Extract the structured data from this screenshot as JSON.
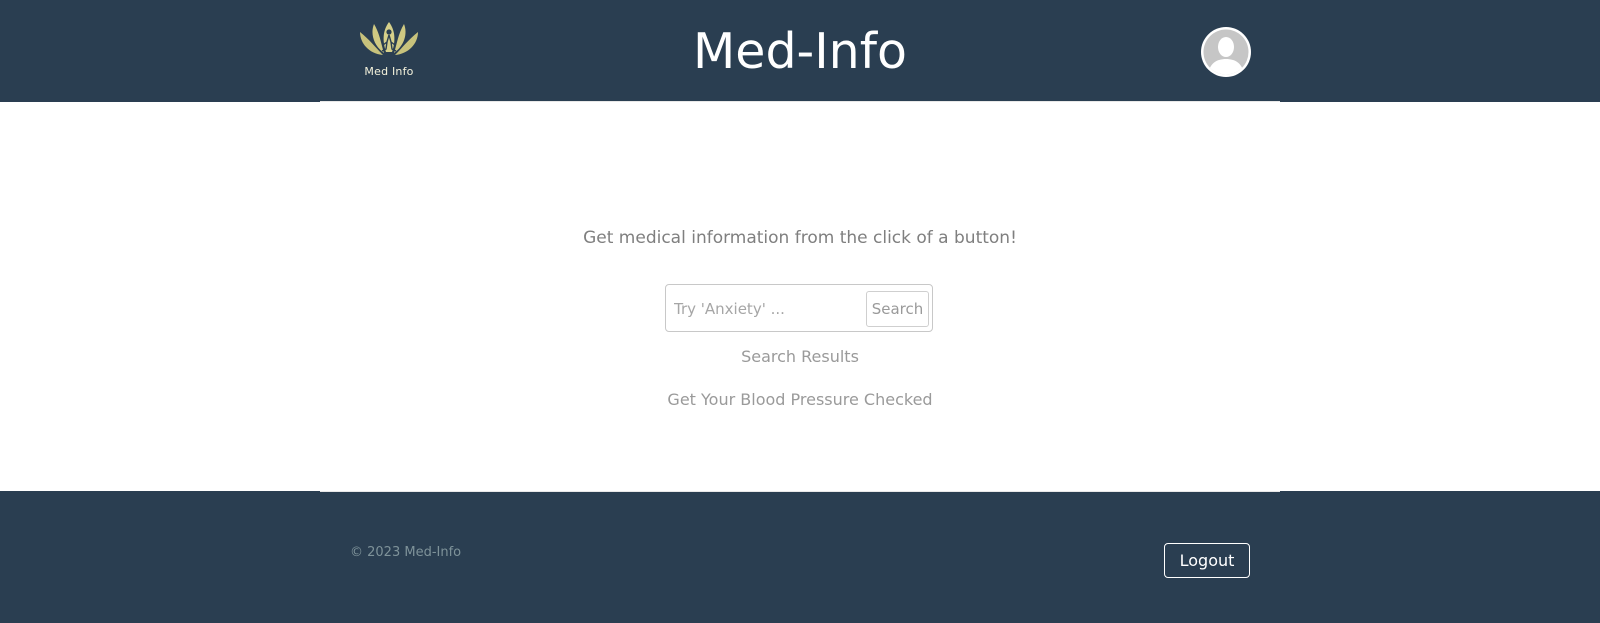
{
  "header": {
    "logo_text": "Med Info",
    "title": "Med-Info",
    "avatar_icon": "user-avatar-icon"
  },
  "main": {
    "tagline": "Get medical information from the click of a button!",
    "search": {
      "placeholder": "Try 'Anxiety' ...",
      "value": "",
      "button_label": "Search"
    },
    "search_results_label": "Search Results",
    "bp_link": "Get Your Blood Pressure Checked"
  },
  "footer": {
    "copyright": "© 2023 Med-Info",
    "logout_label": "Logout"
  },
  "colors": {
    "header_bg": "#2a3e51",
    "logo_gold": "#d6d08a",
    "text_muted": "#7f7f7f"
  }
}
